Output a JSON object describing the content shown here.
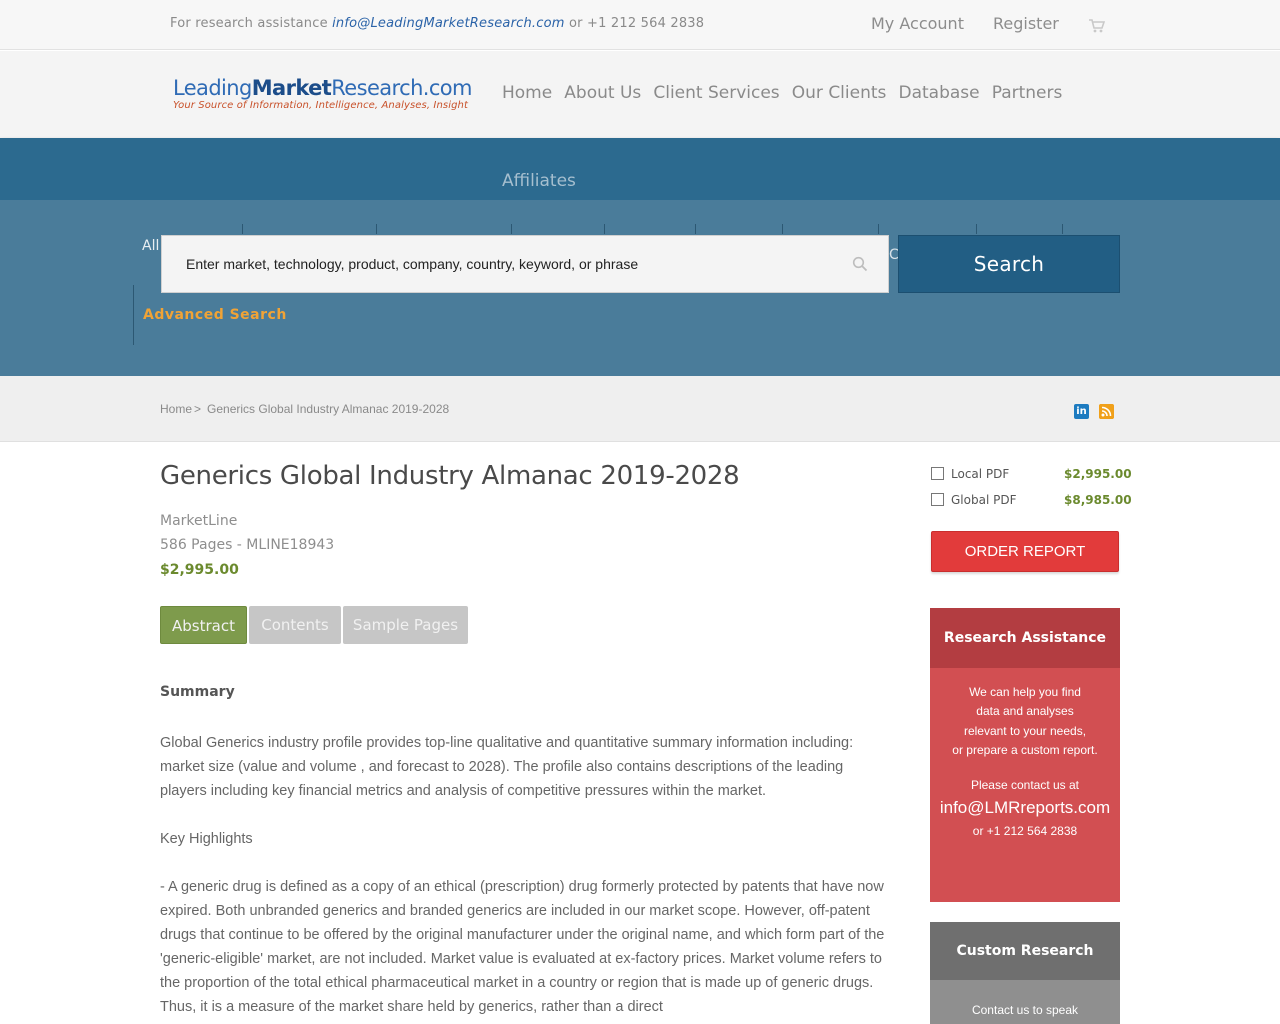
{
  "topbar": {
    "assist_prefix": "For research assistance",
    "email": "info@LeadingMarketResearch.com",
    "phone_text": "or +1 212 564 2838",
    "my_account": "My Account",
    "register": "Register",
    "cart_icon": "cart-icon"
  },
  "logo": {
    "name_part1": "Leading",
    "name_part2": "Market",
    "name_part3": "Research.com",
    "tagline": "Your Source of Information, Intelligence, Analyses, Insight"
  },
  "nav": {
    "items": [
      "Home",
      "About Us",
      "Client Services",
      "Our Clients",
      "Database",
      "Partners"
    ],
    "affiliates": "Affiliates"
  },
  "search": {
    "category": "All",
    "placeholder": "Enter market, technology, product, company, country, keyword, or phrase",
    "truncated_char": "C",
    "button": "Search",
    "advanced": "Advanced Search"
  },
  "breadcrumb": {
    "home": "Home",
    "separator": ">",
    "current": "Generics Global Industry Almanac 2019-2028"
  },
  "social": {
    "linkedin": "in"
  },
  "report": {
    "title": "Generics Global Industry Almanac 2019-2028",
    "publisher": "MarketLine",
    "pages_code": "586 Pages - MLINE18943",
    "price": "$2,995.00"
  },
  "tabs": [
    "Abstract",
    "Contents",
    "Sample Pages"
  ],
  "content": {
    "summary_heading": "Summary",
    "paragraph1": "Global Generics industry profile provides top-line qualitative and quantitative summary information including: market size (value and volume , and forecast to 2028). The profile also contains descriptions of the leading players including key financial metrics and analysis of competitive pressures within the market.",
    "key_highlights": "Key Highlights",
    "paragraph2": "- A generic drug is defined as a copy of an ethical (prescription) drug formerly protected by patents that have now expired. Both unbranded generics and branded generics are included in our market scope. However, off-patent drugs that continue to be offered by the original manufacturer under the original name, and which form part of the 'generic-eligible' market, are not included. Market value is evaluated at ex-factory prices. Market volume refers to the proportion of the total ethical pharmaceutical market in a country or region that is made up of generic drugs. Thus, it is a measure of the market share held by generics, rather than a direct"
  },
  "purchase": {
    "options": [
      {
        "label": "Local PDF",
        "price": "$2,995.00"
      },
      {
        "label": "Global PDF",
        "price": "$8,985.00"
      }
    ],
    "order_button": "ORDER REPORT"
  },
  "research_assistance": {
    "heading": "Research Assistance",
    "lines": [
      "We can help you find",
      "data and analyses",
      "relevant to your needs,",
      "or prepare a custom report."
    ],
    "contact_prompt": "Please contact us at",
    "email": "info@LMRreports.com",
    "phone": "or +1 212 564 2838"
  },
  "custom_research": {
    "heading": "Custom Research",
    "line": "Contact us to speak"
  },
  "colors": {
    "band": "#2c6a8f",
    "search_zone": "#4a7c9a",
    "search_button": "#225e84",
    "price_green": "#6b8a2e",
    "order_red": "#e23b3b",
    "assist_red": "#d24f52",
    "custom_gray": "#8f8f8f"
  }
}
